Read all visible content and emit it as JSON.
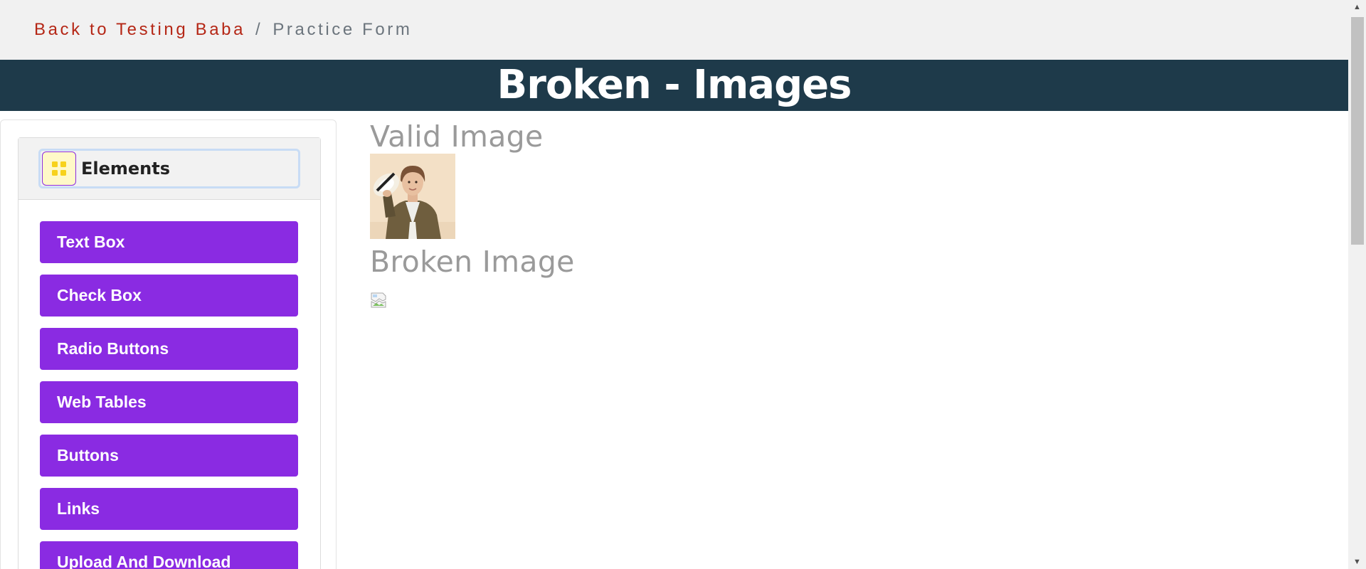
{
  "breadcrumb": {
    "link_label": "Back to Testing Baba",
    "separator": "/",
    "current": "Practice Form"
  },
  "header": {
    "title": "Broken - Images"
  },
  "sidebar": {
    "group_label": "Elements",
    "group_icon": "grid-icon",
    "items": [
      {
        "label": "Text Box"
      },
      {
        "label": "Check Box"
      },
      {
        "label": "Radio Buttons"
      },
      {
        "label": "Web Tables"
      },
      {
        "label": "Buttons"
      },
      {
        "label": "Links"
      },
      {
        "label": "Upload And Download"
      }
    ]
  },
  "main": {
    "valid_heading": "Valid Image",
    "broken_heading": "Broken Image"
  },
  "colors": {
    "breadcrumb_link": "#b52716",
    "banner_bg": "#1e3a4a",
    "menu_button": "#8a2be2",
    "heading_gray": "#9a9a9a"
  }
}
